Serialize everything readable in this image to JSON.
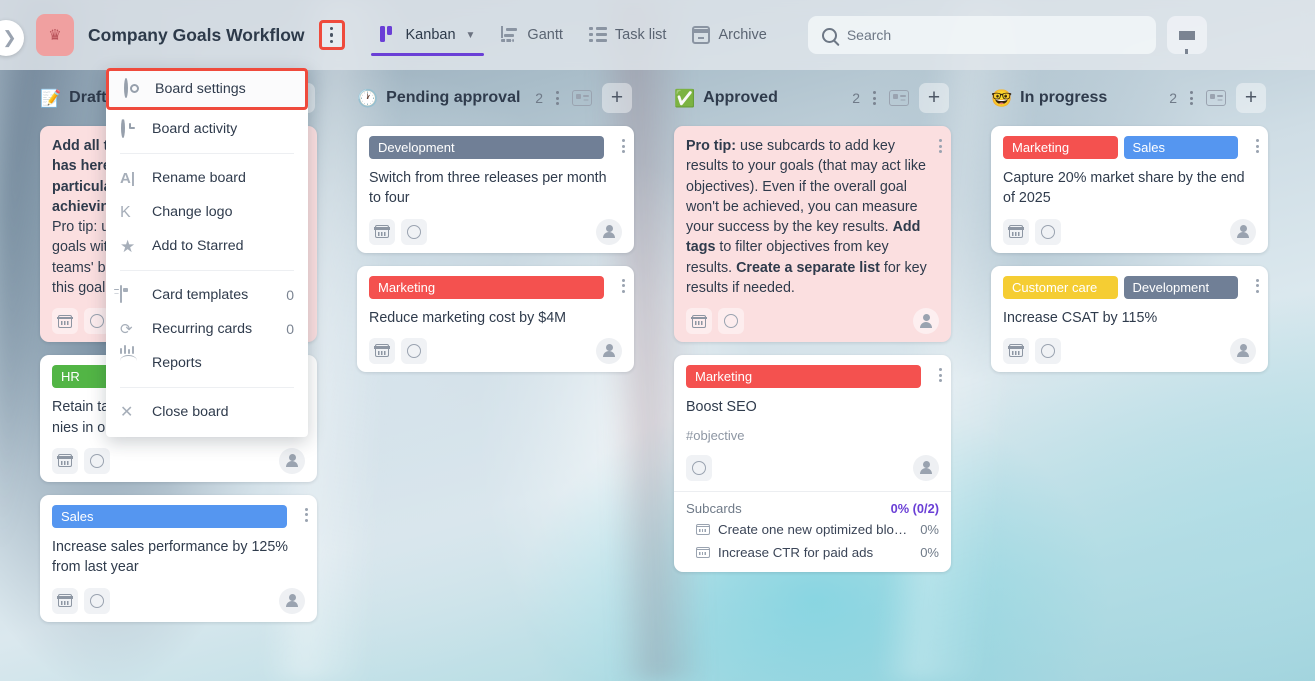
{
  "topbar": {
    "logo_icon": "crown-icon",
    "board_title": "Company Goals Workflow",
    "kebab_icon": "more-vertical-icon",
    "tabs": [
      {
        "label": "Kanban",
        "icon": "kanban-icon",
        "active": true,
        "has_chevron": true
      },
      {
        "label": "Gantt",
        "icon": "gantt-icon",
        "active": false
      },
      {
        "label": "Task list",
        "icon": "task-list-icon",
        "active": false
      },
      {
        "label": "Archive",
        "icon": "archive-icon",
        "active": false
      }
    ],
    "search": {
      "placeholder": "Search",
      "value": "",
      "icon": "search-icon"
    },
    "filter_icon": "filter-funnel-icon",
    "collapse_icon": "chevron-right-icon"
  },
  "menu": {
    "items": [
      {
        "label": "Board settings",
        "icon": "gear-icon",
        "count": "",
        "highlighted": true
      },
      {
        "label": "Board activity",
        "icon": "history-clock-icon",
        "count": ""
      },
      {
        "label": "Rename board",
        "icon": "text-cursor-icon",
        "count": ""
      },
      {
        "label": "Change logo",
        "icon": "letter-k-icon",
        "count": ""
      },
      {
        "label": "Add to Starred",
        "icon": "star-icon",
        "count": ""
      },
      {
        "label": "Card templates",
        "icon": "card-template-icon",
        "count": "0"
      },
      {
        "label": "Recurring cards",
        "icon": "refresh-cycle-icon",
        "count": "0"
      },
      {
        "label": "Reports",
        "icon": "chart-reports-icon",
        "count": ""
      },
      {
        "label": "Close board",
        "icon": "close-x-icon",
        "count": ""
      }
    ]
  },
  "colors": {
    "accent_purple": "#6a3fd6",
    "highlight_red": "#ef4a3c",
    "tag_marketing": "#f4514f",
    "tag_sales": "#5596f0",
    "tag_development": "#707f96",
    "tag_hr": "#52b545",
    "tag_customer_care": "#f5cd33",
    "logo_pink": "#f0a0a0"
  },
  "board": {
    "columns": [
      {
        "emoji": "📝",
        "title": "Drafting",
        "count": "",
        "cards": [
          {
            "style": "tip",
            "tags": [],
            "text_html": "<b>Add all th</b><br><b>has here.</b><br><b>particular</b><br><b>achieving</b><br>Pro tip: u<br>goals with<br>teams' bo<br>this goal.",
            "footer": [
              "calendar-icon",
              "status-circle-icon",
              "avatar"
            ]
          },
          {
            "style": "plain",
            "tags": [
              {
                "label": "HR",
                "color": "#52b545"
              }
            ],
            "text_html": "Retain tal<br>nies in our industry",
            "footer": [
              "calendar-icon",
              "status-circle-icon",
              "avatar"
            ]
          },
          {
            "style": "plain",
            "tags": [
              {
                "label": "Sales",
                "color": "#5596f0"
              }
            ],
            "text_html": "Increase sales performance by 125% from last year",
            "footer": [
              "calendar-icon",
              "status-circle-icon",
              "avatar"
            ]
          }
        ]
      },
      {
        "emoji": "🕐",
        "title": "Pending approval",
        "count": "2",
        "cards": [
          {
            "style": "plain",
            "tags": [
              {
                "label": "Development",
                "color": "#707f96"
              }
            ],
            "text_html": "Switch from three releases per month to four",
            "footer": [
              "calendar-icon",
              "status-circle-icon",
              "avatar"
            ]
          },
          {
            "style": "plain",
            "tags": [
              {
                "label": "Marketing",
                "color": "#f4514f"
              }
            ],
            "text_html": "Reduce marketing cost by $4M",
            "footer": [
              "calendar-icon",
              "status-circle-icon",
              "avatar"
            ]
          }
        ]
      },
      {
        "emoji": "✅",
        "title": "Approved",
        "count": "2",
        "cards": [
          {
            "style": "tip",
            "tags": [],
            "text_html": "<b>Pro tip:</b> use subcards to add key results to your goals (that may act like objectives). Even if the overall goal won't be achieved, you can measure your success by the key results. <b>Add tags</b> to filter objectives from key results. <b>Create a separate list</b> for key results if needed.",
            "footer": [
              "calendar-icon",
              "status-circle-icon",
              "avatar"
            ]
          },
          {
            "style": "plain",
            "tags": [
              {
                "label": "Marketing",
                "color": "#f4514f"
              }
            ],
            "text_html": "Boost SEO",
            "hashtag": "#objective",
            "footer": [
              "status-circle-icon",
              "avatar"
            ],
            "subcards": {
              "label": "Subcards",
              "progress": "0% (0/2)",
              "items": [
                {
                  "label": "Create one new optimized blog pos...",
                  "pct": "0%"
                },
                {
                  "label": "Increase CTR for paid ads",
                  "pct": "0%"
                }
              ]
            }
          }
        ]
      },
      {
        "emoji": "🤓",
        "title": "In progress",
        "count": "2",
        "cards": [
          {
            "style": "plain",
            "tags": [
              {
                "label": "Marketing",
                "color": "#f4514f"
              },
              {
                "label": "Sales",
                "color": "#5596f0"
              }
            ],
            "text_html": "Capture 20% market share by the end of 2025",
            "footer": [
              "calendar-icon",
              "status-circle-icon",
              "avatar"
            ]
          },
          {
            "style": "plain",
            "tags": [
              {
                "label": "Customer care",
                "color": "#f5cd33"
              },
              {
                "label": "Development",
                "color": "#707f96"
              }
            ],
            "text_html": "Increase CSAT by 115%",
            "footer": [
              "calendar-icon",
              "status-circle-icon",
              "avatar"
            ]
          }
        ]
      }
    ],
    "column_controls": {
      "kebab_icon": "more-vertical-icon",
      "template_icon": "card-template-icon",
      "add_icon": "plus-icon"
    }
  }
}
